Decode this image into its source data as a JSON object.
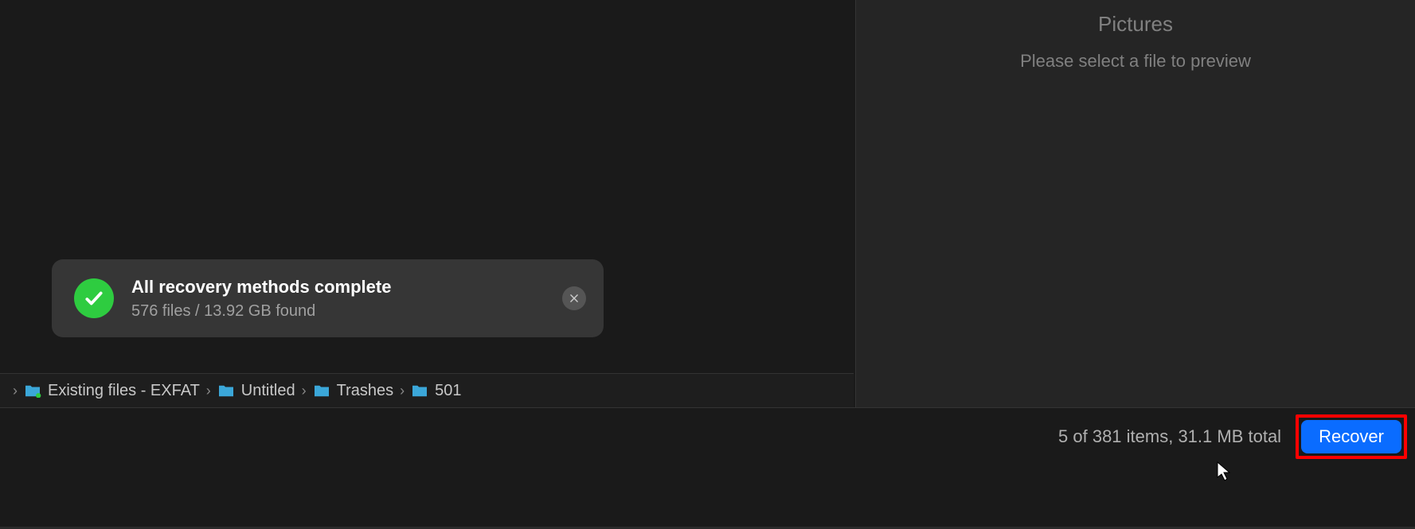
{
  "preview": {
    "title": "Pictures",
    "message": "Please select a file to preview"
  },
  "toast": {
    "title": "All recovery methods complete",
    "subtitle": "576 files / 13.92 GB found"
  },
  "breadcrumb": {
    "items": [
      {
        "label": "Existing files - EXFAT"
      },
      {
        "label": "Untitled"
      },
      {
        "label": "Trashes"
      },
      {
        "label": "501"
      }
    ]
  },
  "statusbar": {
    "text": "5 of 381 items, 31.1 MB total",
    "recover_label": "Recover"
  },
  "colors": {
    "accent": "#0a6cff",
    "success": "#2ecc40",
    "folder": "#3ba7d9",
    "highlight": "#ff0000"
  }
}
